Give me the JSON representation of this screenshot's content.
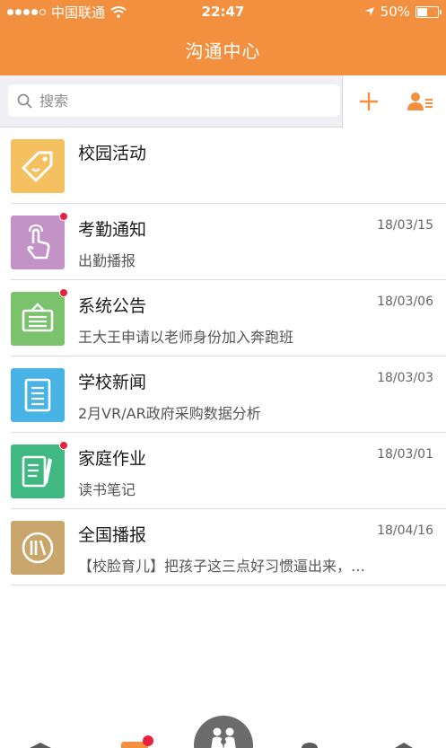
{
  "status": {
    "carrier": "中国联通",
    "time": "22:47",
    "battery": "50%",
    "battery_level": 0.5
  },
  "nav": {
    "title": "沟通中心"
  },
  "search": {
    "placeholder": "搜索"
  },
  "items": [
    {
      "title": "校园活动",
      "date": "",
      "subtitle": "",
      "icon": "tag-icon",
      "color": "#f5c060",
      "badge": false
    },
    {
      "title": "考勤通知",
      "date": "18/03/15",
      "subtitle": "出勤播报",
      "icon": "touch-hand-icon",
      "color": "#c393c8",
      "badge": true
    },
    {
      "title": "系统公告",
      "date": "18/03/06",
      "subtitle": "王大王申请以老师身份加入奔跑班",
      "icon": "announcement-board-icon",
      "color": "#7ac26b",
      "badge": true
    },
    {
      "title": "学校新闻",
      "date": "18/03/03",
      "subtitle": "2月VR/AR政府采购数据分析",
      "icon": "document-icon",
      "color": "#49b3e6",
      "badge": false
    },
    {
      "title": "家庭作业",
      "date": "18/03/01",
      "subtitle": "读书笔记",
      "icon": "homework-pen-icon",
      "color": "#3fb882",
      "badge": true
    },
    {
      "title": "全国播报",
      "date": "18/04/16",
      "subtitle": "【校脸育儿】把孩子这三点好习惯逼出来，…",
      "icon": "broadcast-icon",
      "color": "#c9a66b",
      "badge": false
    }
  ],
  "colors": {
    "accent": "#f2903f",
    "badge": "#e6223f"
  }
}
